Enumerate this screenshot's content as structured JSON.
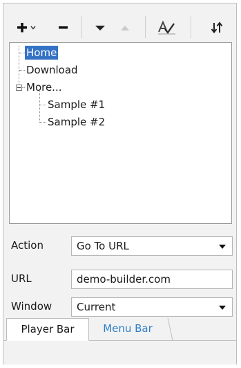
{
  "toolbar": {
    "icons": [
      "add-dropdown-icon",
      "remove-icon",
      "move-down-icon",
      "move-up-icon",
      "spell-check-icon",
      "sort-icon"
    ]
  },
  "tree": {
    "items": [
      {
        "label": "Home",
        "selected": true
      },
      {
        "label": "Download"
      },
      {
        "label": "More...",
        "expanded": true
      },
      {
        "label": "Sample #1"
      },
      {
        "label": "Sample #2"
      }
    ]
  },
  "form": {
    "action_label": "Action",
    "action_value": "Go To URL",
    "url_label": "URL",
    "url_value": "demo-builder.com",
    "window_label": "Window",
    "window_value": "Current"
  },
  "tabs": {
    "player_bar": "Player Bar",
    "menu_bar": "Menu Bar"
  },
  "colors": {
    "selection": "#3372c4",
    "link_tab": "#2f7fc6"
  }
}
